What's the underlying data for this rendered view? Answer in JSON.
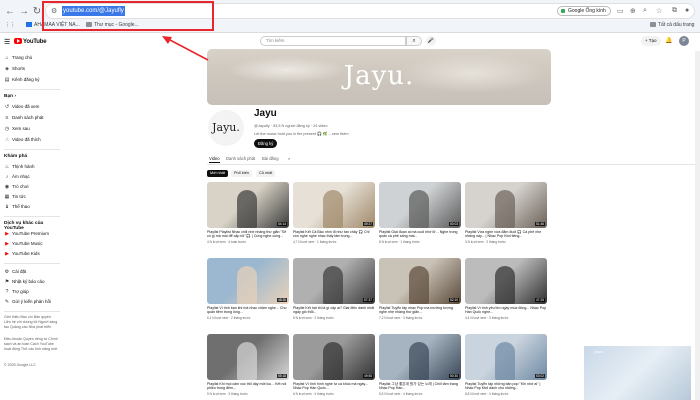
{
  "browser": {
    "url": "youtube.com/@Jayufly",
    "lens_label": "Google Ống kính",
    "bookmarks": [
      {
        "label": "AHAMAA VIỆT NA..."
      },
      {
        "label": "Thư mục - Google..."
      }
    ],
    "all_bookmarks": "Tất cả dấu trang"
  },
  "yt": {
    "search_placeholder": "Tìm kiếm",
    "create_label": "+ Tạo",
    "avatar_letter": "P"
  },
  "sidebar": {
    "main": [
      {
        "label": "Trang chủ",
        "icon": "⌂"
      },
      {
        "label": "Shorts",
        "icon": "◈"
      },
      {
        "label": "Kênh đăng ký",
        "icon": "▤"
      }
    ],
    "you_head": "Bạn ›",
    "you": [
      {
        "label": "Video đã xem",
        "icon": "↺"
      },
      {
        "label": "Danh sách phát",
        "icon": "≡"
      },
      {
        "label": "Xem sau",
        "icon": "◷"
      },
      {
        "label": "Video đã thích",
        "icon": "☝"
      }
    ],
    "explore_head": "Khám phá",
    "explore": [
      {
        "label": "Thịnh hành",
        "icon": "♨"
      },
      {
        "label": "Âm nhạc",
        "icon": "♪"
      },
      {
        "label": "Trò chơi",
        "icon": "◉"
      },
      {
        "label": "Tin tức",
        "icon": "▦"
      },
      {
        "label": "Thể thao",
        "icon": "♝"
      }
    ],
    "more_head": "Dịch vụ khác của YouTube",
    "more": [
      {
        "label": "YouTube Premium",
        "icon": "▶"
      },
      {
        "label": "YouTube Music",
        "icon": "▶"
      },
      {
        "label": "YouTube Kids",
        "icon": "▶"
      }
    ],
    "settings": [
      {
        "label": "Cài đặt",
        "icon": "⚙"
      },
      {
        "label": "Nhật ký báo cáo",
        "icon": "⚑"
      },
      {
        "label": "Trợ giúp",
        "icon": "?"
      },
      {
        "label": "Gửi ý kiến phản hồi",
        "icon": "✎"
      }
    ],
    "footer1": "Giới thiệu  Báo chí  Bản quyền Liên hệ với chúng tôi Người sáng tạo  Quảng cáo Nhà phát triển",
    "footer2": "Điều khoản  Quyền riêng tư Chính sách và an toàn Cách YouTube hoạt động Thử các tính năng mới",
    "copyright": "© 2025 Google LLC"
  },
  "channel": {
    "banner_title": "Jayu.",
    "avatar_text": "Jayu.",
    "name": "Jayu",
    "meta": "@Jayufly · 93,5 N người đăng ký · 24 video",
    "desc": "Let the music hold you in the present 🎧 🌿 ...xem thêm",
    "subscribe": "Đăng ký"
  },
  "tabs": [
    "Video",
    "Danh sách phát",
    "Bài đăng",
    "⌕"
  ],
  "chips": [
    "Mới nhất",
    "Phổ biến",
    "Cũ nhất"
  ],
  "videos": [
    {
      "title": "Playlist Playlist Nhạc chill nhẹ nhàng thư giãn \"Sẽ có gì mà mai để cặp tôi\" 🎧 | Cùng nghe cùng...",
      "meta": "4 N lượt xem · 4 tuần trước",
      "dur": "54:14"
    },
    {
      "title": "Playlist Kết Cá Bảo nhìn đi như tan chảy 🎧 Chỉ còn nghe nghe nhạc thấy tâm trọng...",
      "meta": "4,7 N lượt xem · 1 tháng trước",
      "dur": "49:27"
    },
    {
      "title": "Playlist Giai đoạn ai mà cuối nhớ lữ... Nghe trong quán cà phê sáng mai...",
      "meta": "8 N lượt xem · 1 tháng trước",
      "dur": "50:03"
    },
    {
      "title": "Playlist Vừa nghe vừa đắm đuối 🎧 Cà phê nhẹ nhàng này... | Nhạc Pop Kbd tiếng...",
      "meta": "3 N lượt xem · 2 tháng trước",
      "dur": "51:46"
    },
    {
      "title": "Playlist Vì tình bạn khi mà nhạc chậm nghe...  Cho quán tiệm trong lòng...",
      "meta": "6,1 N lượt xem · 2 tháng trước",
      "dur": "48:36"
    },
    {
      "title": "Playlist Kết hạt tôi là gì cặp ai? Giai điệu dành nhất ngày gió thổi...",
      "meta": "5 N lượt xem · 2 tháng trước",
      "dur": "57:37"
    },
    {
      "title": "Playlist Tuyển tập nhạc Pop ma mường tượng nghe nhẹ nhàng thư giãn...",
      "meta": "7,2 N lượt xem · 3 tháng trước",
      "dur": "52:10"
    },
    {
      "title": "Playlist Vì tình yêu tìm ngày mùa đông... Nhạc Pop Hàn Quốc nghe...",
      "meta": "4,4 N lượt xem · 3 tháng trước",
      "dur": "47:25"
    },
    {
      "title": "Playlist Khi mọi cảm xúc trỗi dậy một lúc... Kết nối phiêu trong đêm...",
      "meta": "9 N lượt xem · 3 tháng trước",
      "dur": "55:18"
    },
    {
      "title": "Playlist Vì tình hình nghe tự ca khúc mà ngày... Nhạc Pop Hàn Quốc...",
      "meta": "6 N lượt xem · 4 tháng trước",
      "dur": "49:55"
    },
    {
      "title": "Playlist 그냥 좋은데 뭔가 있는 노래 | Chill tâm trạng Nhạc Pop Hàn...",
      "meta": "5,5 N lượt xem · 4 tháng trước",
      "dur": "50:30"
    },
    {
      "title": "Playlist Tuyển tập những bản pop \"Khi nhớ ai\" | Nhạc Pop Kbd dành cho những...",
      "meta": "8,8 N lượt xem · 4 tháng trước",
      "dur": "53:02"
    }
  ],
  "colors": {
    "accent": "#e8262b",
    "yt_red": "#ff0000"
  }
}
